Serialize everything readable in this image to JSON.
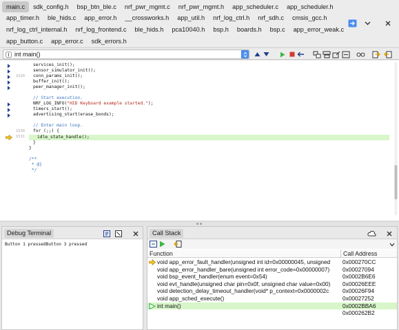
{
  "tabs": {
    "row1": [
      {
        "label": "main.c",
        "active": true
      },
      {
        "label": "sdk_config.h"
      },
      {
        "label": "bsp_btn_ble.c"
      },
      {
        "label": "nrf_pwr_mgmt.c"
      },
      {
        "label": "nrf_pwr_mgmt.h"
      },
      {
        "label": "app_scheduler.c"
      },
      {
        "label": "app_scheduler.h"
      }
    ],
    "row2": [
      {
        "label": "app_timer.h"
      },
      {
        "label": "ble_hids.c"
      },
      {
        "label": "app_error.h"
      },
      {
        "label": "__crossworks.h"
      },
      {
        "label": "app_util.h"
      },
      {
        "label": "nrf_log_ctrl.h"
      },
      {
        "label": "nrf_sdh.c"
      },
      {
        "label": "cmsis_gcc.h"
      }
    ],
    "row3": [
      {
        "label": "nrf_log_ctrl_internal.h"
      },
      {
        "label": "nrf_log_frontend.c"
      },
      {
        "label": "ble_hids.h"
      },
      {
        "label": "pca10040.h"
      },
      {
        "label": "bsp.h"
      },
      {
        "label": "boards.h"
      },
      {
        "label": "bsp.c"
      },
      {
        "label": "app_error_weak.c"
      }
    ],
    "row4": [
      {
        "label": "app_button.c"
      },
      {
        "label": "app_error.c"
      },
      {
        "label": "sdk_errors.h"
      }
    ]
  },
  "navbar": {
    "function_select": "int main()"
  },
  "editor": {
    "line_numbers": {
      "l1520": "1520",
      "l1530": "1530",
      "l1531": "1531"
    },
    "lines": {
      "l0": "services_init();",
      "l1": "sensor_simulator_init();",
      "l2": "conn_params_init();",
      "l3": "buffer_init();",
      "l4": "peer_manager_init();",
      "l6": "// Start execution.",
      "l7a": "NRF_LOG_INFO(",
      "l7b": "\"HID Keyboard example started.\"",
      "l7c": ");",
      "l8": "timers_start();",
      "l9": "advertising_start(erase_bonds);",
      "l11": "// Enter main loop.",
      "l12": "for (;;) {",
      "l13": "idle_state_handle();",
      "l14": "}",
      "l15": "}",
      "l17": "/**",
      "l18": " * @}",
      "l19": " */"
    }
  },
  "debug_terminal": {
    "title": "Debug Terminal",
    "output": "Button 1 pressedButton 3 pressed"
  },
  "call_stack": {
    "title": "Call Stack",
    "col_function": "Function",
    "col_address": "Call Address",
    "rows": [
      {
        "function": "void app_error_fault_handler(unsigned int id=0x00000045, unsigned",
        "address": "0x000270CC",
        "marker": "yellow-arrow"
      },
      {
        "function": "void app_error_handler_bare(unsigned int error_code=0x00000007)",
        "address": "0x00027094"
      },
      {
        "function": "void bsp_event_handler(enum event=0x54)",
        "address": "0x0002B6E6"
      },
      {
        "function": "void evt_handle(unsigned char pin=0x0f, unsigned char value=0x00)",
        "address": "0x00026EEE"
      },
      {
        "function": "void detection_delay_timeout_handler(void* p_context=0x0000002c",
        "address": "0x00026F94"
      },
      {
        "function": "void app_sched_execute()",
        "address": "0x00027252"
      },
      {
        "function": "int main()",
        "address": "0x0002BBA6",
        "marker": "green-arrow"
      },
      {
        "function": "",
        "address": "0x000262B2"
      }
    ]
  },
  "colors": {
    "accent_blue": "#4b8df0",
    "current_line": "#d8f6c9",
    "comment": "#3c73c4",
    "string": "#b2261b"
  }
}
